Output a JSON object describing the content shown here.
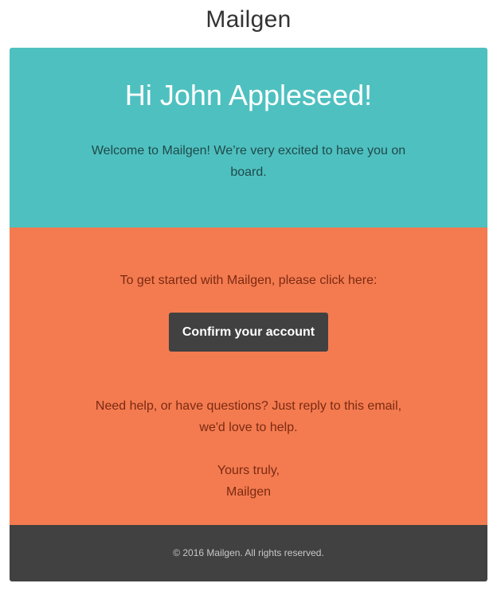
{
  "brand": {
    "name": "Mailgen"
  },
  "header": {
    "greeting": "Hi John Appleseed!",
    "intro": "Welcome to Mailgen! We’re very excited to have you on board."
  },
  "body": {
    "action_instructions": "To get started with Mailgen, please click here:",
    "button_label": "Confirm your account",
    "help_text": "Need help, or have questions? Just reply to this email, we'd love to help.",
    "signoff_line1": "Yours truly,",
    "signoff_line2": "Mailgen"
  },
  "footer": {
    "copyright": "© 2016 Mailgen. All rights reserved."
  },
  "colors": {
    "header_bg": "#4fc0c0",
    "body_bg": "#f47b50",
    "button_bg": "#414141",
    "footer_bg": "#414141"
  }
}
